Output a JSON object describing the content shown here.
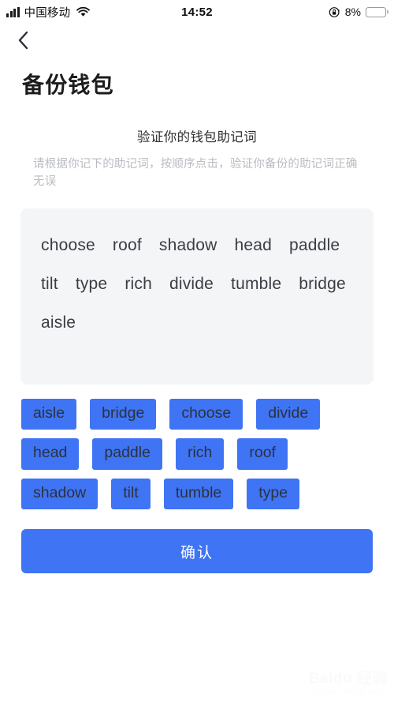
{
  "status_bar": {
    "carrier": "中国移动",
    "time": "14:52",
    "battery_percent": "8%",
    "battery_level": 8,
    "signal_bars": 4,
    "icons": [
      "signal-bars-icon",
      "wifi-icon",
      "rotation-lock-icon",
      "battery-icon"
    ]
  },
  "nav": {
    "back_label": "返回"
  },
  "header": {
    "title": "备份钱包"
  },
  "instructions": {
    "title": "验证你的钱包助记词",
    "description": "请根据你记下的助记词，按顺序点击，验证你备份的助记词正确无误"
  },
  "mnemonic_panel": {
    "selected_words": [
      "choose",
      "roof",
      "shadow",
      "head",
      "paddle",
      "tilt",
      "type",
      "rich",
      "divide",
      "tumble",
      "bridge",
      "aisle"
    ]
  },
  "word_bank": {
    "chips": [
      "aisle",
      "bridge",
      "choose",
      "divide",
      "head",
      "paddle",
      "rich",
      "roof",
      "shadow",
      "tilt",
      "tumble",
      "type"
    ]
  },
  "actions": {
    "confirm_label": "确认"
  },
  "watermark": {
    "main": "Baidu 经验",
    "sub": "jingyan.baidu.com"
  },
  "colors": {
    "accent_blue": "#3f74f4",
    "panel_bg": "#f4f5f7",
    "battery_red": "#fa2f28",
    "muted_text": "#b9bcc2"
  }
}
